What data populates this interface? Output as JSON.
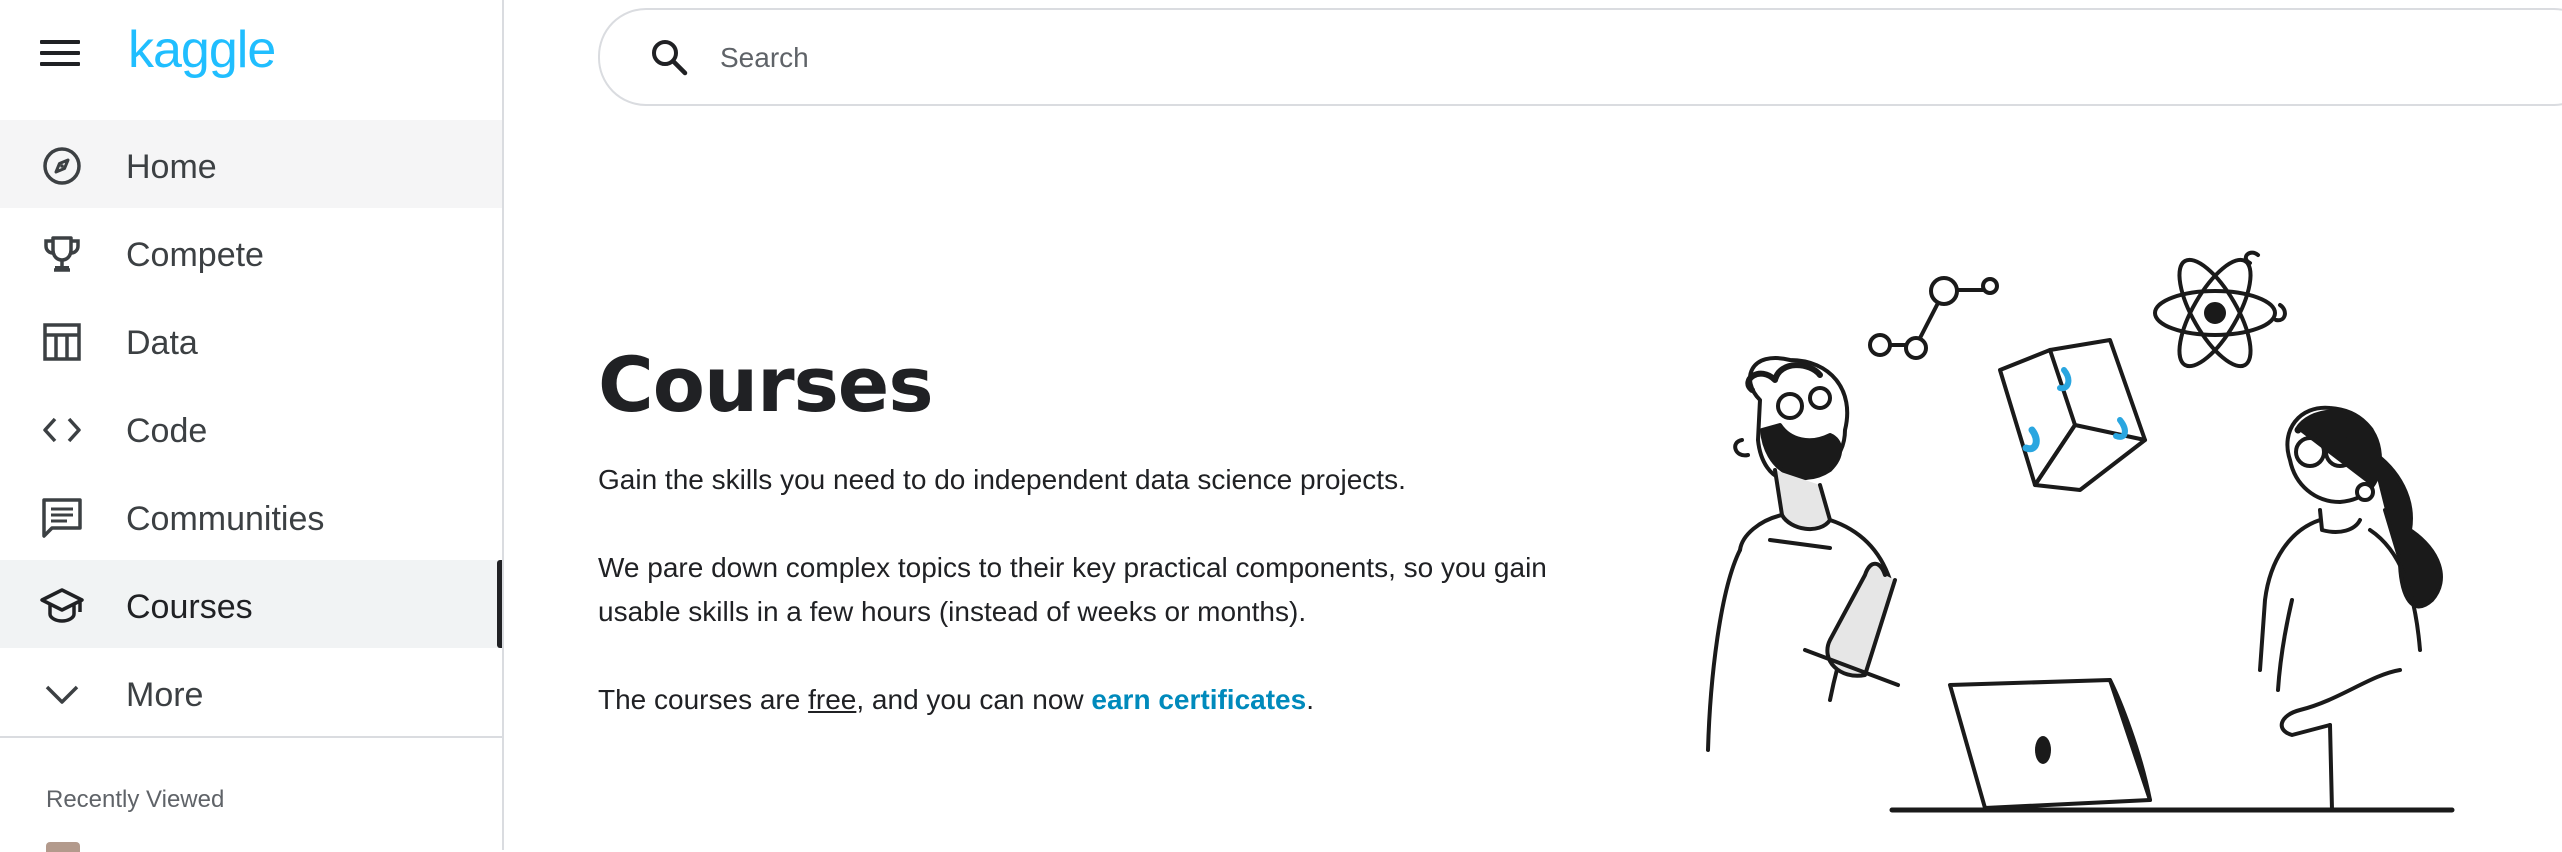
{
  "app": {
    "logo": "kaggle"
  },
  "search": {
    "placeholder": "Search"
  },
  "sidebar": {
    "items": [
      {
        "label": "Home",
        "icon": "compass-icon"
      },
      {
        "label": "Compete",
        "icon": "trophy-icon"
      },
      {
        "label": "Data",
        "icon": "table-icon"
      },
      {
        "label": "Code",
        "icon": "code-icon"
      },
      {
        "label": "Communities",
        "icon": "comment-icon"
      },
      {
        "label": "Courses",
        "icon": "school-icon",
        "active": true
      },
      {
        "label": "More",
        "icon": "chevron-down-icon"
      }
    ],
    "recent_title": "Recently Viewed"
  },
  "main": {
    "title": "Courses",
    "para1": "Gain the skills you need to do independent data science projects.",
    "para2": "We pare down complex topics to their key practical components, so you gain usable skills in a few hours (instead of weeks or months).",
    "para3_prefix": "The courses are ",
    "para3_free": "free",
    "para3_mid": ", and you can now ",
    "para3_cert": "earn certificates",
    "para3_suffix": "."
  },
  "colors": {
    "brand": "#20beff",
    "link": "#008abc",
    "accent_blue": "#2aa6e0"
  }
}
